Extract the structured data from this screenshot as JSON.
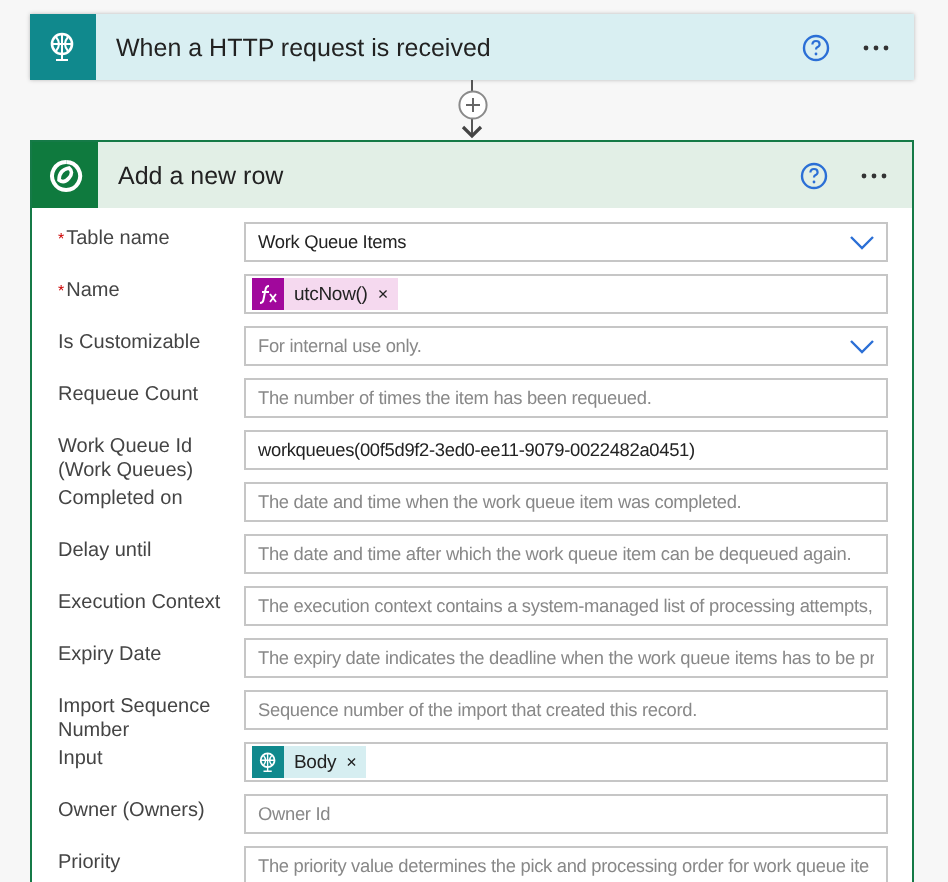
{
  "trigger": {
    "title": "When a HTTP request is received"
  },
  "action": {
    "title": "Add a new row",
    "fields": [
      {
        "label": "Table name",
        "required_mark": "*",
        "kind": "dropdown",
        "value": "Work Queue Items"
      },
      {
        "label": "Name",
        "required_mark": "*",
        "kind": "tokens",
        "tokens": [
          {
            "kind": "expression",
            "text": "utcNow()",
            "remove": "×"
          }
        ]
      },
      {
        "label": "Is Customizable",
        "kind": "dropdown",
        "placeholder": "For internal use only."
      },
      {
        "label": "Requeue Count",
        "kind": "text",
        "placeholder": "The number of times the item has been requeued."
      },
      {
        "label": "Work Queue Id (Work Queues)",
        "kind": "text",
        "value": "workqueues(00f5d9f2-3ed0-ee11-9079-0022482a0451)"
      },
      {
        "label": "Completed on",
        "kind": "text",
        "placeholder": "The date and time when the work queue item was completed."
      },
      {
        "label": "Delay until",
        "kind": "text",
        "placeholder": "The date and time after which the work queue item can be dequeued again."
      },
      {
        "label": "Execution Context",
        "kind": "text",
        "placeholder": "The execution context contains a system-managed list of processing attempts,"
      },
      {
        "label": "Expiry Date",
        "kind": "text",
        "placeholder": "The expiry date indicates the deadline when the work queue items has to be pr"
      },
      {
        "label": "Import Sequence Number",
        "kind": "text",
        "placeholder": "Sequence number of the import that created this record."
      },
      {
        "label": "Input",
        "kind": "tokens",
        "tokens": [
          {
            "kind": "trigger-output",
            "text": "Body",
            "remove": "×"
          }
        ]
      },
      {
        "label": "Owner (Owners)",
        "kind": "text",
        "placeholder": "Owner Id"
      },
      {
        "label": "Priority",
        "kind": "text",
        "placeholder": "The priority value determines the pick and processing order for work queue ite"
      }
    ]
  }
}
